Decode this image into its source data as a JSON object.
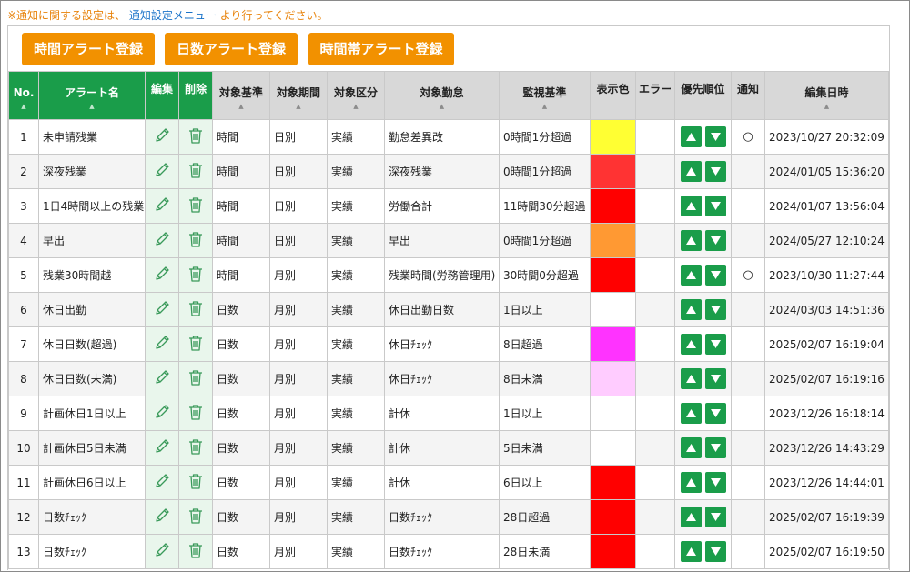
{
  "notice": {
    "prefix": "※通知に関する設定は、",
    "link": "通知設定メニュー",
    "suffix": "より行ってください。"
  },
  "buttons": {
    "time_alert": "時間アラート登録",
    "days_alert": "日数アラート登録",
    "timeband_alert": "時間帯アラート登録"
  },
  "colors": {
    "accent_orange": "#f29100",
    "header_green": "#1a9d4a",
    "notice_orange": "#e8830b",
    "link_blue": "#1a73c9"
  },
  "table": {
    "headers": {
      "no": "No.",
      "alert_name": "アラート名",
      "edit": "編集",
      "delete": "削除",
      "basis": "対象基準",
      "period": "対象期間",
      "category": "対象区分",
      "attendance": "対象勤怠",
      "monitor": "監視基準",
      "display_color": "表示色",
      "error": "エラー",
      "priority": "優先順位",
      "notify": "通知",
      "edited_at": "編集日時"
    },
    "rows": [
      {
        "no": "1",
        "name": "未申請残業",
        "basis": "時間",
        "period": "日別",
        "category": "実績",
        "attendance": "勤怠差異改",
        "monitor": "0時間1分超過",
        "color": "#ffff33",
        "error": "",
        "notify": "○",
        "edited": "2023/10/27 20:32:09"
      },
      {
        "no": "2",
        "name": "深夜残業",
        "basis": "時間",
        "period": "日別",
        "category": "実績",
        "attendance": "深夜残業",
        "monitor": "0時間1分超過",
        "color": "#ff3333",
        "error": "",
        "notify": "",
        "edited": "2024/01/05 15:36:20"
      },
      {
        "no": "3",
        "name": "1日4時間以上の残業",
        "basis": "時間",
        "period": "日別",
        "category": "実績",
        "attendance": "労働合計",
        "monitor": "11時間30分超過",
        "color": "#ff0000",
        "error": "",
        "notify": "",
        "edited": "2024/01/07 13:56:04"
      },
      {
        "no": "4",
        "name": "早出",
        "basis": "時間",
        "period": "日別",
        "category": "実績",
        "attendance": "早出",
        "monitor": "0時間1分超過",
        "color": "#ff9933",
        "error": "",
        "notify": "",
        "edited": "2024/05/27 12:10:24"
      },
      {
        "no": "5",
        "name": "残業30時間越",
        "basis": "時間",
        "period": "月別",
        "category": "実績",
        "attendance": "残業時間(労務管理用)",
        "monitor": "30時間0分超過",
        "color": "#ff0000",
        "error": "",
        "notify": "○",
        "edited": "2023/10/30 11:27:44"
      },
      {
        "no": "6",
        "name": "休日出勤",
        "basis": "日数",
        "period": "月別",
        "category": "実績",
        "attendance": "休日出勤日数",
        "monitor": "1日以上",
        "color": "#ffffff",
        "error": "",
        "notify": "",
        "edited": "2024/03/03 14:51:36"
      },
      {
        "no": "7",
        "name": "休日日数(超過)",
        "basis": "日数",
        "period": "月別",
        "category": "実績",
        "attendance": "休日ﾁｪｯｸ",
        "monitor": "8日超過",
        "color": "#ff33ff",
        "error": "",
        "notify": "",
        "edited": "2025/02/07 16:19:04"
      },
      {
        "no": "8",
        "name": "休日日数(未満)",
        "basis": "日数",
        "period": "月別",
        "category": "実績",
        "attendance": "休日ﾁｪｯｸ",
        "monitor": "8日未満",
        "color": "#ffccff",
        "error": "",
        "notify": "",
        "edited": "2025/02/07 16:19:16"
      },
      {
        "no": "9",
        "name": "計画休日1日以上",
        "basis": "日数",
        "period": "月別",
        "category": "実績",
        "attendance": "計休",
        "monitor": "1日以上",
        "color": "#ffffff",
        "error": "",
        "notify": "",
        "edited": "2023/12/26 16:18:14"
      },
      {
        "no": "10",
        "name": "計画休日5日未満",
        "basis": "日数",
        "period": "月別",
        "category": "実績",
        "attendance": "計休",
        "monitor": "5日未満",
        "color": "#ffffff",
        "error": "",
        "notify": "",
        "edited": "2023/12/26 14:43:29"
      },
      {
        "no": "11",
        "name": "計画休日6日以上",
        "basis": "日数",
        "period": "月別",
        "category": "実績",
        "attendance": "計休",
        "monitor": "6日以上",
        "color": "#ff0000",
        "error": "",
        "notify": "",
        "edited": "2023/12/26 14:44:01"
      },
      {
        "no": "12",
        "name": "日数ﾁｪｯｸ",
        "basis": "日数",
        "period": "月別",
        "category": "実績",
        "attendance": "日数ﾁｪｯｸ",
        "monitor": "28日超過",
        "color": "#ff0000",
        "error": "",
        "notify": "",
        "edited": "2025/02/07 16:19:39"
      },
      {
        "no": "13",
        "name": "日数ﾁｪｯｸ",
        "basis": "日数",
        "period": "月別",
        "category": "実績",
        "attendance": "日数ﾁｪｯｸ",
        "monitor": "28日未満",
        "color": "#ff0000",
        "error": "",
        "notify": "",
        "edited": "2025/02/07 16:19:50"
      }
    ]
  }
}
